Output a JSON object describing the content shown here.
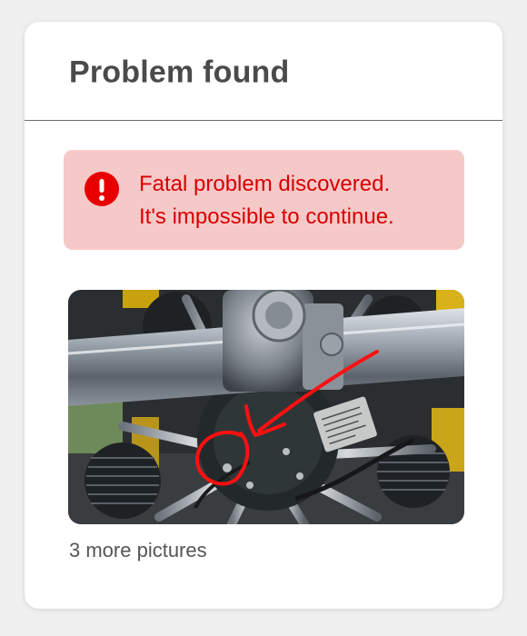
{
  "dialog": {
    "title": "Problem found"
  },
  "alert": {
    "icon": "exclamation-circle-icon",
    "line1": "Fatal problem discovered.",
    "line2": "It's impossible to continue.",
    "colors": {
      "background": "#f6c9c9",
      "text": "#d80000",
      "icon": "#e80000"
    }
  },
  "photo": {
    "subject": "radial aircraft engine with red hand-drawn arrow and circle annotation",
    "annotation_color": "#ff0000"
  },
  "more_pictures": {
    "label": "3 more pictures"
  }
}
